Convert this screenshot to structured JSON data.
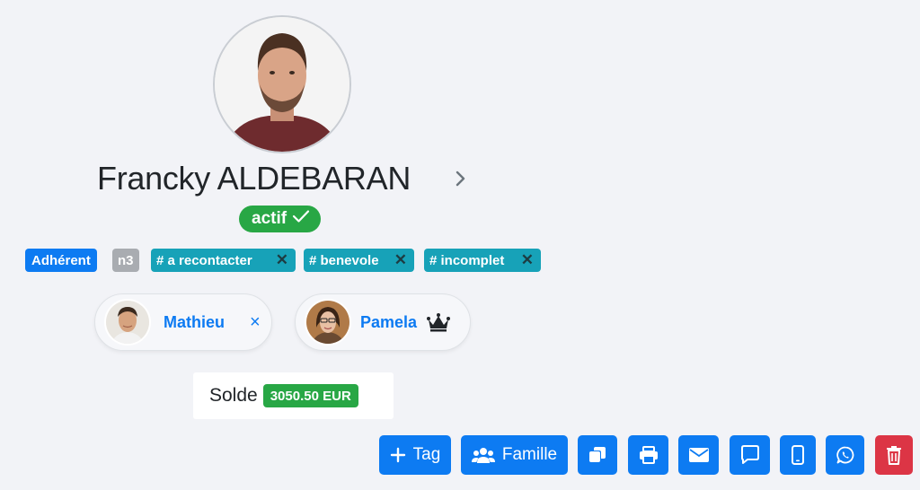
{
  "profile": {
    "name": "Francky ALDEBARAN",
    "status": "actif"
  },
  "badges": {
    "member_type": "Adhérent",
    "level": "n3",
    "tags": [
      "# a recontacter",
      "# benevole",
      "# incomplet"
    ]
  },
  "family": [
    {
      "name": "Mathieu",
      "action": "×"
    },
    {
      "name": "Pamela",
      "role_icon": "crown-icon"
    }
  ],
  "balance": {
    "label": "Solde",
    "amount": "3050.50 EUR"
  },
  "toolbar": {
    "tag_label": "Tag",
    "family_label": "Famille",
    "icons": [
      "plus-icon",
      "users-icon",
      "duplicate-icon",
      "print-icon",
      "email-icon",
      "message-icon",
      "mobile-icon",
      "whatsapp-icon",
      "trash-icon"
    ]
  },
  "colors": {
    "primary": "#0d7bf2",
    "success": "#28a745",
    "info": "#17a2b8",
    "danger": "#dc3545",
    "secondary": "#a9acb1"
  }
}
